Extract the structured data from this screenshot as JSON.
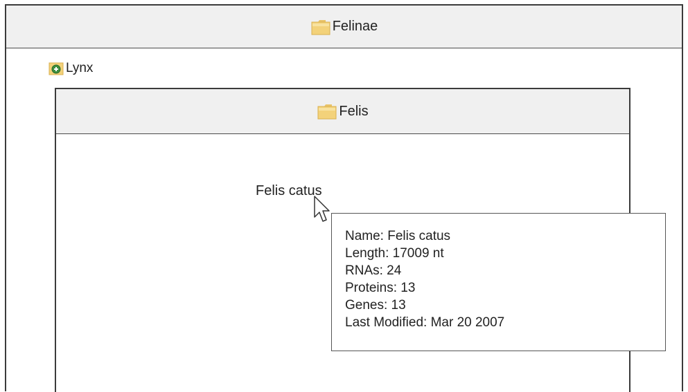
{
  "outer_panel": {
    "title": "Felinae",
    "icon": "folder-icon"
  },
  "collapsed_node": {
    "label": "Lynx",
    "icon": "expand-node-icon"
  },
  "inner_panel": {
    "title": "Felis",
    "icon": "folder-icon"
  },
  "leaf": {
    "label": "Felis catus"
  },
  "tooltip": {
    "name": "Name: Felis catus",
    "length": "Length: 17009 nt",
    "rnas": "RNAs: 24",
    "proteins": "Proteins: 13",
    "genes": "Genes: 13",
    "last_modified": "Last Modified: Mar 20 2007"
  },
  "colors": {
    "folder": "#f3d27a",
    "header_bg": "#f0f0f0",
    "border": "#3b3b3b",
    "node_green": "#3e8e3e"
  }
}
